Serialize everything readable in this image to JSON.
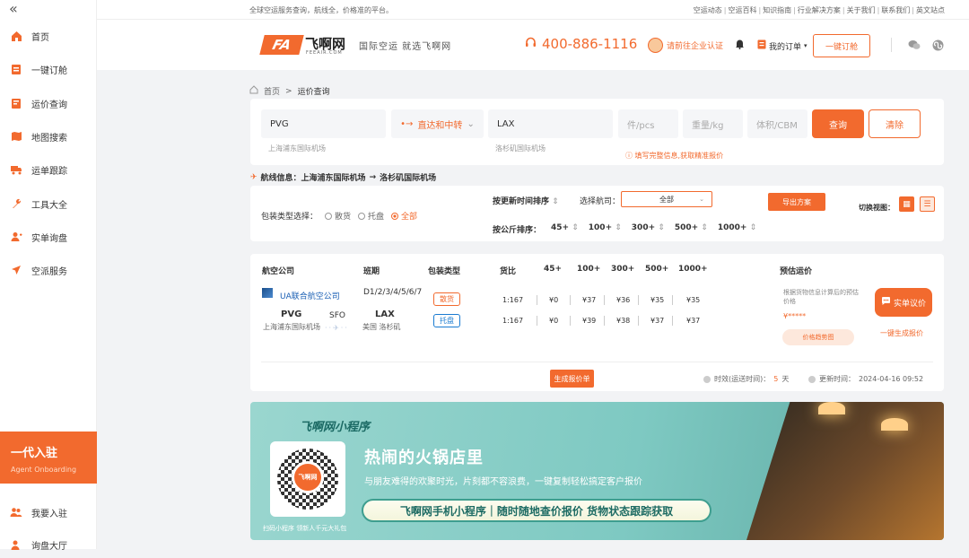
{
  "sidebar": {
    "collapse_icon": "double-chevron-left-icon",
    "items": [
      {
        "label": "首页",
        "icon": "home-icon"
      },
      {
        "label": "一键订舱",
        "icon": "booking-icon"
      },
      {
        "label": "运价查询",
        "icon": "rate-icon"
      },
      {
        "label": "地图搜索",
        "icon": "map-icon"
      },
      {
        "label": "运单跟踪",
        "icon": "truck-icon"
      },
      {
        "label": "工具大全",
        "icon": "wrench-icon"
      },
      {
        "label": "实单询盘",
        "icon": "user-icon"
      },
      {
        "label": "空派服务",
        "icon": "plane-icon"
      }
    ],
    "agent": {
      "title": "一代入驻",
      "subtitle": "Agent Onboarding"
    },
    "bottom_items": [
      {
        "label": "我要入驻",
        "icon": "users-icon"
      },
      {
        "label": "询盘大厅",
        "icon": "hall-icon"
      }
    ]
  },
  "topbar": {
    "slogan": "全球空运服务查询，航线全，价格准的平台。",
    "links": [
      "空运动态",
      "空运百科",
      "知识指南",
      "行业解决方案",
      "关于我们",
      "联系我们",
      "英文站点"
    ]
  },
  "header": {
    "logo_mark": "FA",
    "logo_name": "飞啊网",
    "logo_sub": "FEEAIR.COM",
    "tagline": "国际空运  就选飞啊网",
    "phone": "400-886-1116",
    "cert_label": "请前往企业认证",
    "my_orders": "我的订单",
    "oneclick_button": "一键订舱"
  },
  "breadcrumb": {
    "home": "首页",
    "sep": ">",
    "current": "运价查询"
  },
  "search": {
    "origin": "PVG",
    "origin_sub": "上海浦东国际机场",
    "mode": "直达和中转",
    "dest": "LAX",
    "dest_sub": "洛杉矶国际机场",
    "pcs_placeholder": "件/pcs",
    "weight_placeholder": "重量/kg",
    "volume_placeholder": "体积/CBM",
    "query_button": "查询",
    "clear_button": "清除",
    "hint": "填写完整信息,获取精准报价"
  },
  "route_info": {
    "label": "航线信息：上海浦东国际机场",
    "arrow": "→",
    "dest": "洛杉矶国际机场"
  },
  "filters": {
    "packing_label": "包装类型选择：",
    "packing_options": [
      "散货",
      "托盘",
      "全部"
    ],
    "packing_selected": "全部",
    "sort_by_update": "按更新时间排序",
    "airline_label": "选择航司：",
    "airline_value": "全部",
    "sort_by_weight": "按公斤排序：",
    "weight_tiers": [
      "45+",
      "100+",
      "300+",
      "500+",
      "1000+"
    ],
    "export_button": "导出方案",
    "view_label": "切换视图："
  },
  "table": {
    "headers": [
      "航空公司",
      "班期",
      "包装类型",
      "货比",
      "45+",
      "100+",
      "300+",
      "500+",
      "1000+",
      "预估运价"
    ],
    "row": {
      "airline": "UA联合航空公司",
      "schedule": "D1/2/3/4/5/6/7",
      "origin_code": "PVG",
      "origin_name": "上海浦东国际机场",
      "transit": "SFO",
      "dest_code": "LAX",
      "dest_name": "美国 洛杉矶",
      "rates": [
        {
          "type": "散货",
          "ratio": "1:167",
          "prices": [
            "¥0",
            "¥37",
            "¥36",
            "¥35",
            "¥35"
          ]
        },
        {
          "type": "托盘",
          "ratio": "1:167",
          "prices": [
            "¥0",
            "¥39",
            "¥38",
            "¥37",
            "¥37"
          ]
        }
      ],
      "estimate_note": "根据货物信息计算后的预估价格",
      "estimate_price": "¥*****",
      "trend_button": "价格趋势图",
      "inquiry_button": "实单议价",
      "generate_link": "一键生成报价"
    },
    "gen_quote_button": "生成报价单",
    "validity_label": "时效(运送时间)：",
    "validity_value": "5",
    "validity_unit": "天",
    "updated_label": "更新时间：",
    "updated_value": "2024-04-16 09:52"
  },
  "banner": {
    "brand": "飞啊网小程序",
    "qr_label": "飞啊网",
    "qr_caption": "扫码小程序 领新人千元大礼包",
    "title": "热闹的火锅店里",
    "subtitle": "与朋友难得的欢聚时光，片刻都不容浪费，一键复制轻松搞定客户报价",
    "pill": "飞啊网手机小程序｜随时随地查价报价 货物状态跟踪获取"
  },
  "colors": {
    "accent": "#f26a2e",
    "link": "#1a5fb4",
    "pallet": "#1a7bd1"
  }
}
